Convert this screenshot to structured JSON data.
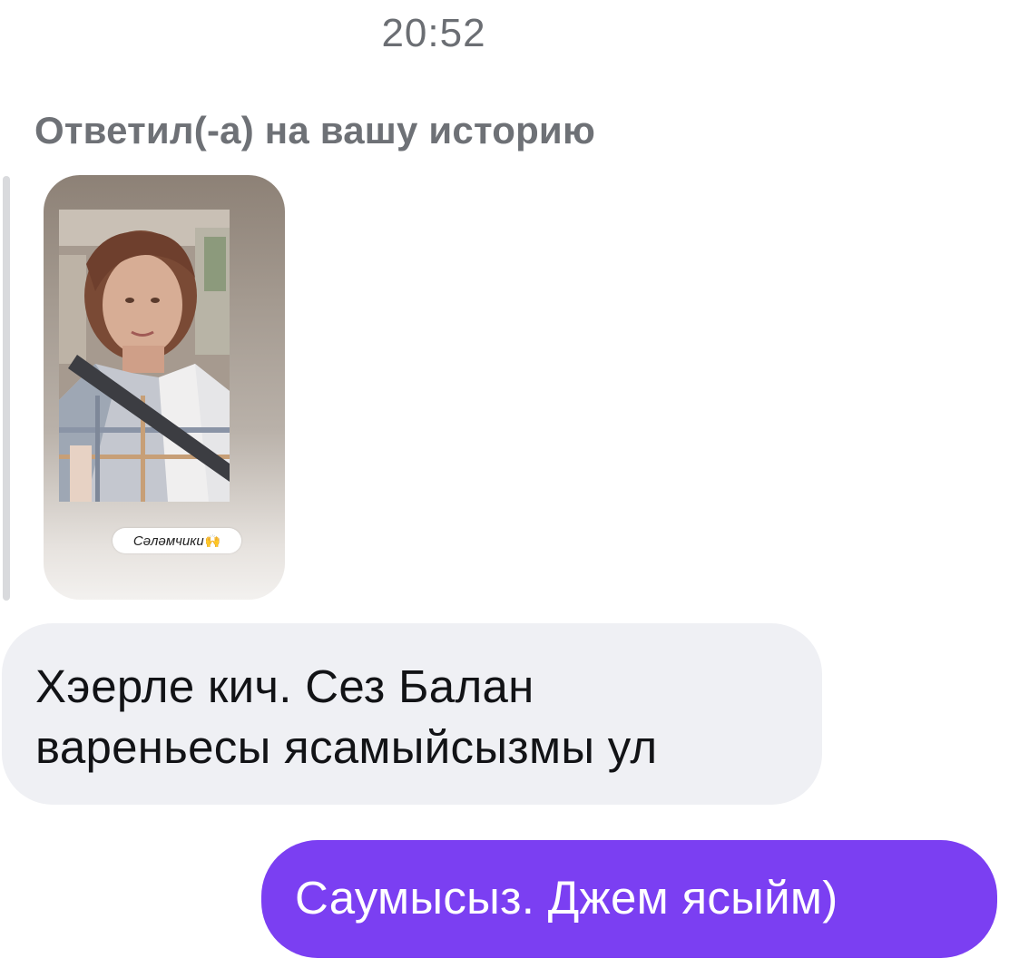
{
  "chat": {
    "timestamp": "20:52",
    "reply_caption": "Ответил(-а) на вашу историю",
    "story": {
      "sticker_text": "Сәләмчики",
      "sticker_icon": "raising-hands-icon"
    },
    "messages": [
      {
        "direction": "incoming",
        "lines": [
          "Хэерле кич. Сез Балан",
          "вареньесы ясамыйсызмы ул"
        ]
      },
      {
        "direction": "outgoing",
        "text": "Саумысыз. Джем ясыйм)"
      }
    ]
  },
  "colors": {
    "incoming_bubble": "#eff0f4",
    "outgoing_bubble": "#7b3ff2",
    "secondary_text": "#6e7176"
  }
}
